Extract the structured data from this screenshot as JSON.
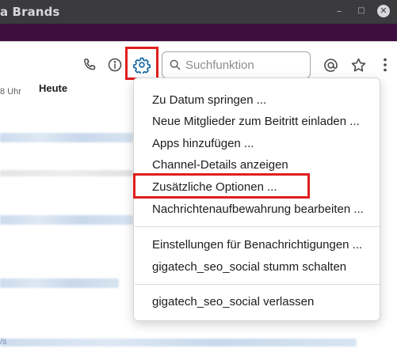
{
  "window": {
    "title": "a Brands",
    "minimize_glyph": "–",
    "maximize_glyph": "□",
    "close_glyph": "✕"
  },
  "header": {
    "icons": [
      "phone-icon",
      "info-icon",
      "gear-icon",
      "at-icon",
      "star-icon",
      "more-icon"
    ],
    "search": {
      "placeholder": "Suchfunktion"
    }
  },
  "messages": {
    "day_divider": "Heute",
    "time_fragment": "8 Uhr",
    "link_fragment": "/s"
  },
  "menu": {
    "group1": [
      "Zu Datum springen ...",
      "Neue Mitglieder zum Beitritt einladen ...",
      "Apps hinzufügen ...",
      "Channel-Details anzeigen",
      "Zusätzliche Optionen ...",
      "Nachrichtenaufbewahrung bearbeiten ..."
    ],
    "group2": [
      "Einstellungen für Benachrichtigungen ...",
      "gigatech_seo_social stumm schalten"
    ],
    "group3": [
      "gigatech_seo_social verlassen"
    ]
  },
  "colors": {
    "titlebar": "#3b3a3c",
    "workspace_bar": "#3f0e40",
    "gear_accent": "#1264a3",
    "annotation_red": "#e01e1e"
  }
}
